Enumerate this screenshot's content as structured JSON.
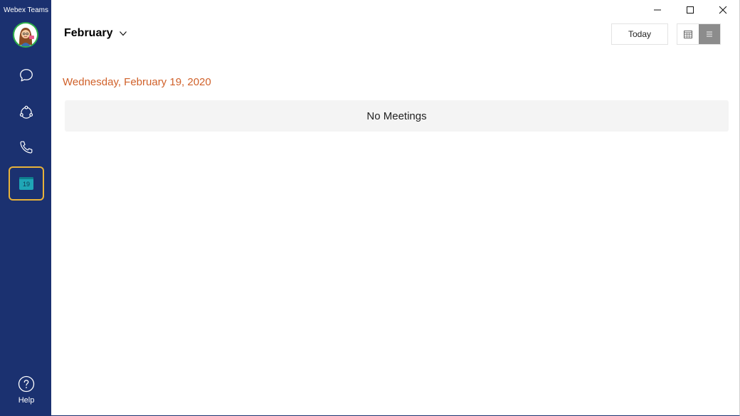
{
  "app": {
    "title": "Webex Teams"
  },
  "sidebar": {
    "items": [
      {
        "id": "messaging",
        "icon": "chat-bubble-icon"
      },
      {
        "id": "teams",
        "icon": "teams-icon"
      },
      {
        "id": "calling",
        "icon": "phone-icon"
      },
      {
        "id": "meetings",
        "icon": "calendar-icon",
        "badge": "19",
        "active": true
      }
    ],
    "help_label": "Help",
    "colors": {
      "background": "#1b3170",
      "active_border": "#e8b23a",
      "calendar_badge": "#1fa6b6"
    }
  },
  "window_controls": [
    "minimize-icon",
    "maximize-icon",
    "close-icon"
  ],
  "header": {
    "month": "February",
    "today_label": "Today",
    "views": [
      {
        "icon": "calendar-grid-icon",
        "active": false
      },
      {
        "icon": "list-icon",
        "active": true
      }
    ]
  },
  "agenda": {
    "date_heading": "Wednesday, February 19, 2020",
    "date_color": "#d0612a",
    "empty_text": "No Meetings"
  }
}
